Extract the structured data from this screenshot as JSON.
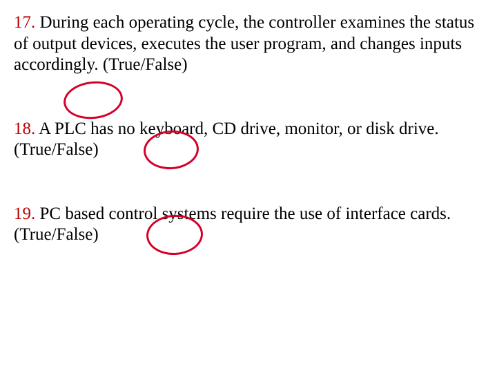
{
  "questions": [
    {
      "number": "17.",
      "text": "During each operating cycle, the controller examines the status of output devices, executes the user program, and changes inputs accordingly.  (True/False)",
      "circled": "False"
    },
    {
      "number": "18.",
      "text": "A PLC has no keyboard, CD drive, monitor, or disk drive.   (True/False)",
      "circled": "True"
    },
    {
      "number": "19.",
      "text": "PC based control systems require the use of interface cards.   (True/False)",
      "circled": "True"
    }
  ]
}
